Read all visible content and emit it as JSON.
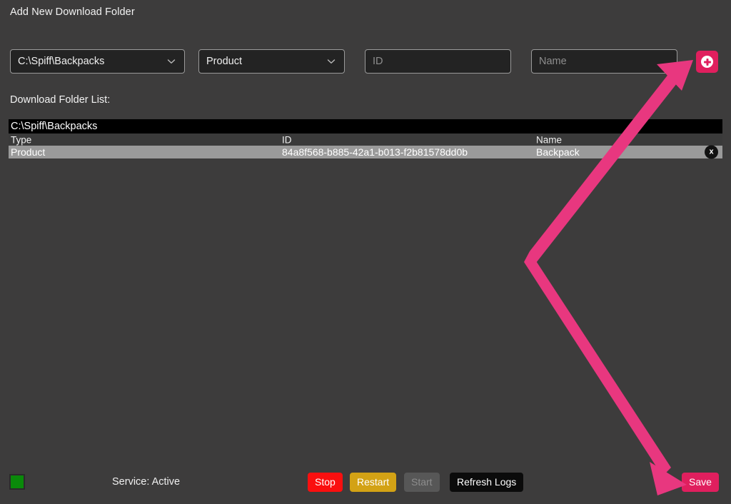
{
  "header": {
    "title": "Add New Download Folder"
  },
  "form": {
    "path_select": {
      "value": "C:\\Spiff\\Backpacks",
      "icon": "chevron-down-icon"
    },
    "type_select": {
      "value": "Product",
      "icon": "chevron-down-icon"
    },
    "id_input": {
      "value": "",
      "placeholder": "ID"
    },
    "name_input": {
      "value": "",
      "placeholder": "Name"
    },
    "add_button": {
      "icon": "plus-circle-icon",
      "color": "#e01f5e"
    }
  },
  "list": {
    "label": "Download Folder List:",
    "folders": [
      {
        "path": "C:\\Spiff\\Backpacks",
        "columns": [
          "Type",
          "ID",
          "Name"
        ],
        "rows": [
          {
            "type": "Product",
            "id": "84a8f568-b885-42a1-b013-f2b81578dd0b",
            "name": "Backpack",
            "delete_label": "x"
          }
        ]
      }
    ]
  },
  "footer": {
    "status_color": "#0a8a0a",
    "status_text": "Service: Active",
    "buttons": {
      "stop": "Stop",
      "restart": "Restart",
      "start": "Start",
      "refresh_logs": "Refresh Logs",
      "save": "Save"
    }
  },
  "annotation": {
    "color": "#e8377f",
    "shape": "double-ended-arrow",
    "points_from": "save-button",
    "points_to": "add-folder-button"
  }
}
